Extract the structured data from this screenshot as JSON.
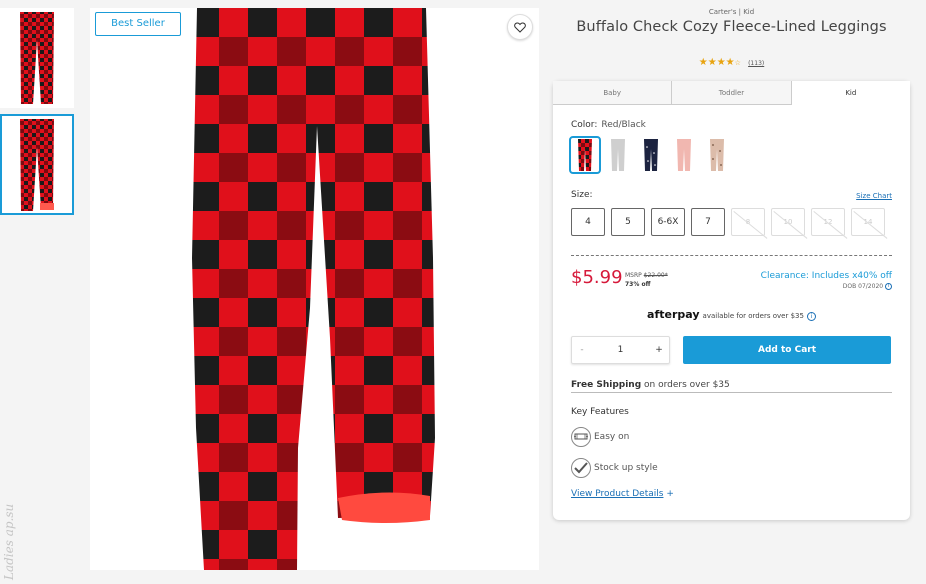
{
  "product": {
    "brand_line": "Carter's | Kid",
    "title": "Buffalo Check Cozy Fleece-Lined Leggings",
    "stars": "★★★★",
    "half_star": "☆",
    "review_count": "(113)",
    "badge": "Best Seller"
  },
  "tabs": [
    {
      "label": "Baby",
      "active": false
    },
    {
      "label": "Toddler",
      "active": false
    },
    {
      "label": "Kid",
      "active": true
    }
  ],
  "color": {
    "label": "Color:",
    "selected": "Red/Black",
    "swatches": [
      {
        "name": "red-black",
        "color": "#c8202b"
      },
      {
        "name": "grey",
        "color": "#c9c9c9"
      },
      {
        "name": "navy",
        "color": "#1c2340"
      },
      {
        "name": "pink",
        "color": "#f1b7b0"
      },
      {
        "name": "leopard",
        "color": "#d9b7a4"
      }
    ]
  },
  "size": {
    "label": "Size:",
    "chart_link": "Size Chart",
    "options": [
      {
        "label": "4",
        "available": true
      },
      {
        "label": "5",
        "available": true
      },
      {
        "label": "6-6X",
        "available": true
      },
      {
        "label": "7",
        "available": true
      },
      {
        "label": "8",
        "available": false
      },
      {
        "label": "10",
        "available": false
      },
      {
        "label": "12",
        "available": false
      },
      {
        "label": "14",
        "available": false
      }
    ]
  },
  "pricing": {
    "price": "$5.99",
    "msrp_label": "MSRP",
    "msrp_value": "$22.00*",
    "percent_off": "73% off",
    "clearance": "Clearance: Includes x40% off",
    "dob": "DOB 07/2020",
    "info": "i"
  },
  "afterpay": {
    "logo": "afterpay",
    "text": "available for orders over $35",
    "info": "i"
  },
  "cart": {
    "qty_minus": "-",
    "qty_value": "1",
    "qty_plus": "+",
    "add_label": "Add to Cart"
  },
  "shipping": {
    "bold": "Free Shipping",
    "rest": "on orders over $35"
  },
  "features": {
    "title": "Key Features",
    "items": [
      {
        "label": "Easy on",
        "icon": "waistband-icon"
      },
      {
        "label": "Stock up style",
        "icon": "check-icon"
      }
    ]
  },
  "details_link": "View Product Details",
  "details_plus": "+",
  "watermark": "Ladies ap.su",
  "colors": {
    "accent": "#1a9bd7",
    "price": "#d6193a",
    "star": "#e8a30f",
    "plaid_red": "#e0101b",
    "plaid_black": "#1a1a1a"
  }
}
